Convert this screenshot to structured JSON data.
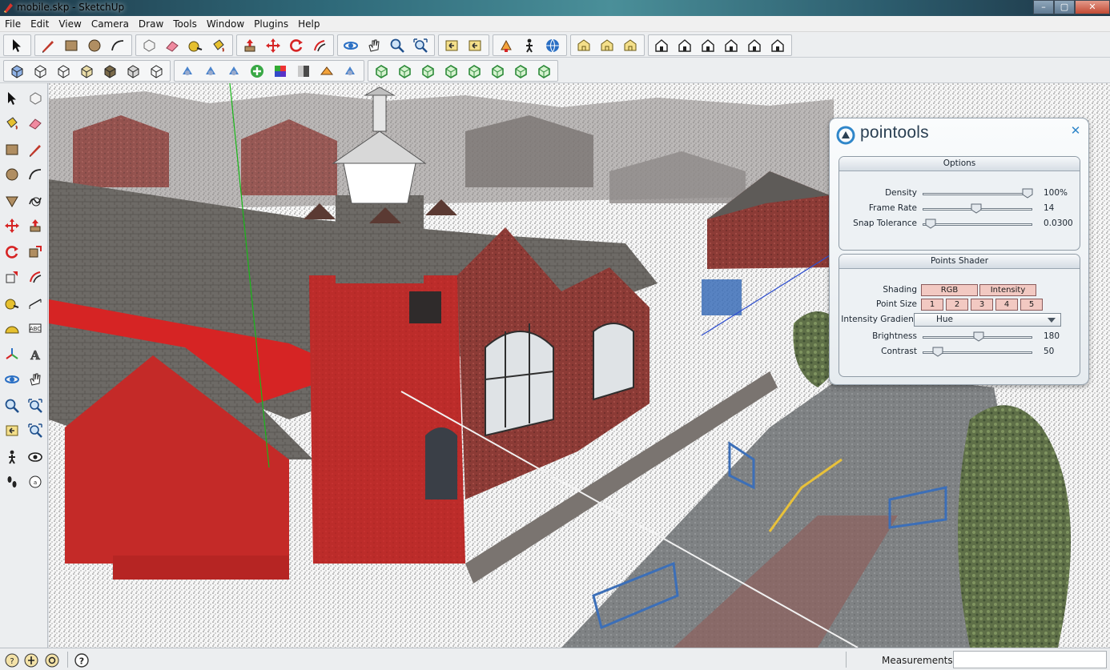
{
  "window": {
    "title": "mobile.skp - SketchUp",
    "controls": {
      "minimize": "–",
      "maximize": "▢",
      "close": "✕"
    }
  },
  "menu": [
    "File",
    "Edit",
    "View",
    "Camera",
    "Draw",
    "Tools",
    "Window",
    "Plugins",
    "Help"
  ],
  "toolbar_row1": {
    "groups": [
      {
        "icons": [
          "select-arrow-icon"
        ]
      },
      {
        "icons": [
          "pencil-line-icon",
          "rectangle-icon",
          "circle-icon",
          "arc-icon"
        ]
      },
      {
        "icons": [
          "make-component-icon",
          "eraser-icon",
          "tape-measure-icon",
          "paint-bucket-icon"
        ]
      },
      {
        "icons": [
          "push-pull-icon",
          "move-icon",
          "rotate-icon",
          "offset-icon"
        ]
      },
      {
        "icons": [
          "orbit-icon",
          "pan-hand-icon",
          "zoom-icon",
          "zoom-extents-icon"
        ]
      },
      {
        "icons": [
          "previous-view-icon",
          "next-view-icon"
        ]
      },
      {
        "icons": [
          "position-camera-icon",
          "walk-icon",
          "get-models-icon"
        ]
      },
      {
        "icons": [
          "share-model-icon",
          "share-component-icon",
          "get-photo-texture-icon"
        ]
      },
      {
        "icons": [
          "iso-view-icon",
          "top-view-icon",
          "front-view-icon",
          "right-view-icon",
          "back-view-icon",
          "left-view-icon"
        ]
      }
    ]
  },
  "toolbar_row2": {
    "groups": [
      {
        "icons": [
          "xray-icon",
          "wireframe-icon",
          "hidden-line-icon",
          "shaded-icon",
          "shaded-textures-icon",
          "monochrome-icon",
          "back-edges-icon"
        ]
      },
      {
        "icons": [
          "pointools-open-icon",
          "pointools-edit-icon",
          "pointools-layers-icon",
          "pointools-add-icon",
          "pointools-rgb-icon",
          "pointools-plain-icon",
          "pointools-intensity-icon",
          "pointools-clip-icon"
        ]
      },
      {
        "icons": [
          "component-outline-icon",
          "component-solid-icon",
          "component-check-icon",
          "component-stack-icon",
          "component-select-icon",
          "component-paint-icon",
          "component-delete-icon",
          "component-export-icon"
        ]
      }
    ]
  },
  "left_tools": [
    "select-arrow-icon",
    "make-component-icon",
    "paint-bucket-icon",
    "eraser-icon",
    "rectangle-icon",
    "pencil-line-icon",
    "circle-icon",
    "arc-icon",
    "polygon-icon",
    "freehand-icon",
    "move-icon",
    "push-pull-icon",
    "rotate-icon",
    "follow-me-icon",
    "scale-icon",
    "offset-icon",
    "tape-measure-icon",
    "dimension-icon",
    "protractor-icon",
    "text-icon",
    "axes-icon",
    "3d-text-icon",
    "orbit-icon",
    "pan-hand-icon",
    "zoom-icon",
    "zoom-window-icon",
    "previous-view-icon",
    "zoom-extents-icon",
    "walk-icon",
    "look-around-icon",
    "footprints-icon",
    "section-plane-icon"
  ],
  "pointools": {
    "brand": "pointools",
    "close_label": "✕",
    "options": {
      "header": "Options",
      "rows": [
        {
          "label": "Density",
          "value": "100%",
          "fraction": 1.0
        },
        {
          "label": "Frame Rate",
          "value": "14",
          "fraction": 0.49
        },
        {
          "label": "Snap Tolerance",
          "value": "0.0300",
          "fraction": 0.03
        }
      ]
    },
    "shader": {
      "header": "Points Shader",
      "shading_label": "Shading",
      "shading_options": [
        "RGB",
        "Intensity"
      ],
      "point_size_label": "Point Size",
      "point_sizes": [
        "1",
        "2",
        "3",
        "4",
        "5"
      ],
      "gradient_label": "Intensity Gradient",
      "gradient_value": "Hue",
      "brightness_label": "Brightness",
      "brightness_value": "180",
      "brightness_fraction": 0.51,
      "contrast_label": "Contrast",
      "contrast_value": "50",
      "contrast_fraction": 0.1
    }
  },
  "status": {
    "icons": [
      "geo-location-icon",
      "credits-icon",
      "user-account-icon",
      "help-icon"
    ],
    "measurements_label": "Measurements",
    "measurements_value": ""
  },
  "colors": {
    "brick_red": "#d62424",
    "roof_gray": "#6e6a64",
    "pointools_accent": "#2f86c9",
    "toggle_pink": "#f2c9c2"
  }
}
